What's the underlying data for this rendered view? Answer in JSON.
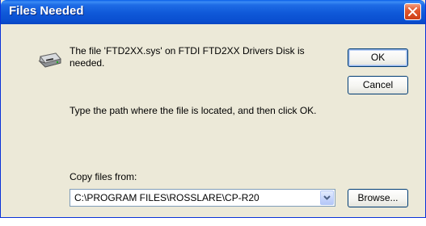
{
  "window": {
    "title": "Files Needed"
  },
  "icons": {
    "disk": "floppy-drive-icon",
    "close": "close-icon",
    "dropdown": "chevron-down-icon"
  },
  "message": {
    "line1": "The file 'FTD2XX.sys' on FTDI FTD2XX Drivers Disk is needed.",
    "line2": "Type the path where the file is located, and then click OK."
  },
  "copy_from": {
    "label": "Copy files from:",
    "value": "C:\\PROGRAM FILES\\ROSSLARE\\CP-R20"
  },
  "buttons": {
    "ok": "OK",
    "cancel": "Cancel",
    "browse": "Browse..."
  },
  "colors": {
    "titlebar": "#0a58d8",
    "close": "#e2592f",
    "dialog_bg": "#ece9d8"
  }
}
